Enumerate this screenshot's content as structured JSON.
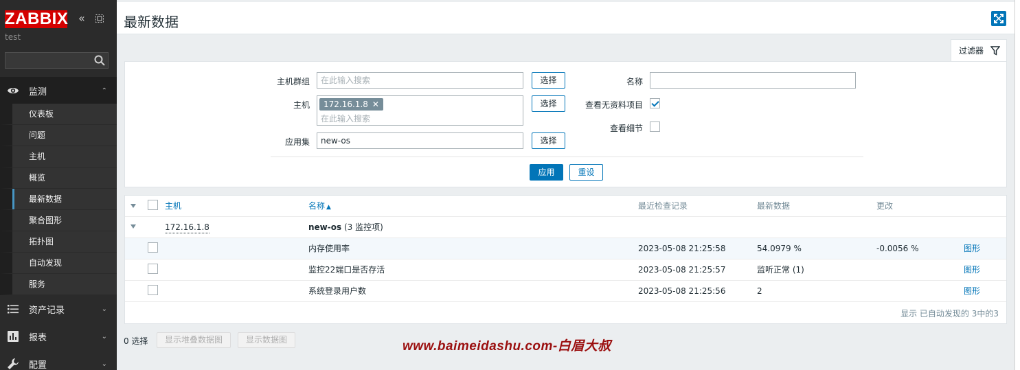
{
  "sidebar": {
    "logo": "ZABBIX",
    "server_name": "test",
    "sections": [
      {
        "label": "监测",
        "icon": "eye-icon"
      },
      {
        "label": "资产记录",
        "icon": "list-icon"
      },
      {
        "label": "报表",
        "icon": "bar-chart-icon"
      },
      {
        "label": "配置",
        "icon": "wrench-icon"
      }
    ],
    "monitoring_items": [
      "仪表板",
      "问题",
      "主机",
      "概览",
      "最新数据",
      "聚合图形",
      "拓扑图",
      "自动发现",
      "服务"
    ],
    "selected_item": "最新数据"
  },
  "header": {
    "title": "最新数据"
  },
  "filter": {
    "tab_label": "过滤器",
    "host_group_label": "主机群组",
    "host_group_placeholder": "在此输入搜索",
    "host_label": "主机",
    "host_tag": "172.16.1.8",
    "host_placeholder": "在此输入搜索",
    "application_label": "应用集",
    "application_value": "new-os",
    "select_label": "选择",
    "name_label": "名称",
    "name_value": "",
    "show_no_data_label": "查看无资料项目",
    "show_no_data_checked": true,
    "show_details_label": "查看细节",
    "show_details_checked": false,
    "apply_label": "应用",
    "reset_label": "重设"
  },
  "table": {
    "columns": {
      "host": "主机",
      "name": "名称",
      "last_check": "最近检查记录",
      "last_value": "最新数据",
      "change": "更改"
    },
    "sort_arrow": "▲",
    "group_host": "172.16.1.8",
    "group_app": "new-os",
    "group_count": "(3 监控项)",
    "rows": [
      {
        "name": "内存使用率",
        "last_check": "2023-05-08 21:25:58",
        "last_value": "54.0979 %",
        "change": "-0.0056 %",
        "action": "图形"
      },
      {
        "name": "监控22端口是否存活",
        "last_check": "2023-05-08 21:25:57",
        "last_value": "监听正常 (1)",
        "change": "",
        "action": "图形"
      },
      {
        "name": "系统登录用户数",
        "last_check": "2023-05-08 21:25:56",
        "last_value": "2",
        "change": "",
        "action": "图形"
      }
    ],
    "footer": "显示 已自动发现的 3中的3"
  },
  "bottom": {
    "selected_count": "0 选择",
    "stacked_graph_button": "显示堆叠数据图",
    "graph_button": "显示数据图"
  },
  "watermark": "www.baimeidashu.com-白眉大叔",
  "colors": {
    "accent": "#0275b8",
    "logo_red": "#d40000",
    "sidebar_bg": "#2b2b2b"
  }
}
